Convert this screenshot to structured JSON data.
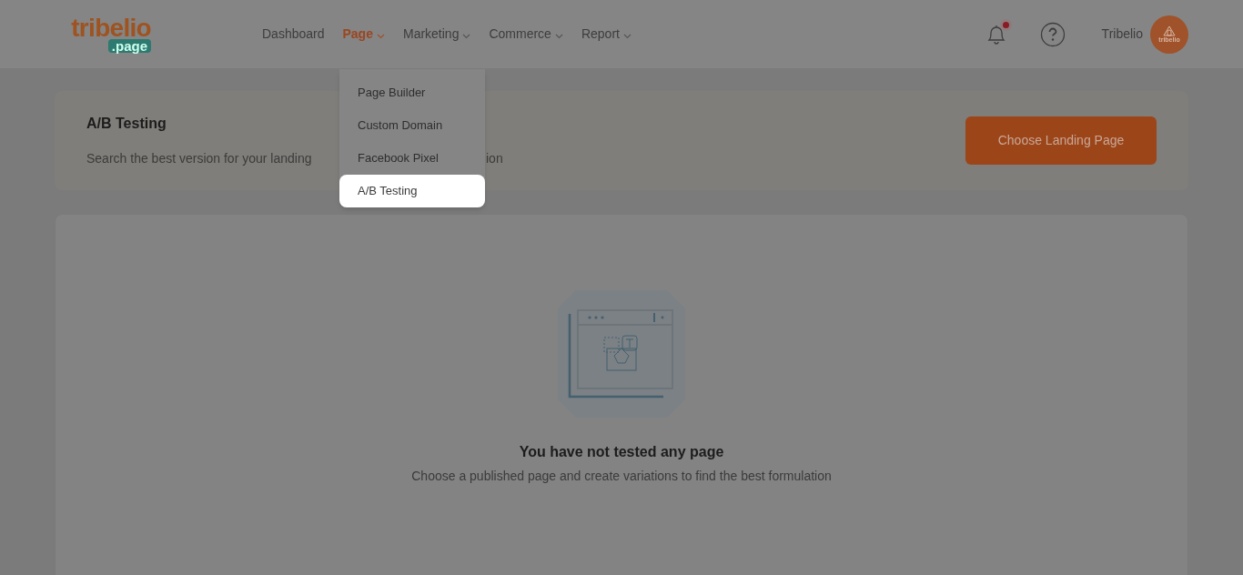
{
  "logo": {
    "name": "tribelio",
    "badge": ".page"
  },
  "nav": [
    {
      "label": "Dashboard",
      "selected": false,
      "dropdown": false
    },
    {
      "label": "Page",
      "selected": true,
      "dropdown": true
    },
    {
      "label": "Marketing",
      "selected": false,
      "dropdown": true
    },
    {
      "label": "Commerce",
      "selected": false,
      "dropdown": true
    },
    {
      "label": "Report",
      "selected": false,
      "dropdown": true
    }
  ],
  "notifications": {
    "unread": true
  },
  "user": {
    "name": "Tribelio",
    "avatar_text": "tribelio"
  },
  "dropdown_menu": [
    {
      "label": "Page Builder",
      "selected": false
    },
    {
      "label": "Custom Domain",
      "selected": false
    },
    {
      "label": "Facebook Pixel",
      "selected": false
    },
    {
      "label": "A/B Testing",
      "selected": true
    }
  ],
  "header_card": {
    "title": "A/B Testing",
    "subtitle_start": "Search the best version for your landing",
    "subtitle_end": "ion",
    "button": "Choose Landing Page"
  },
  "empty_state": {
    "title": "You have not tested any page",
    "message": "Choose a published page and create variations to find the best formulation"
  }
}
